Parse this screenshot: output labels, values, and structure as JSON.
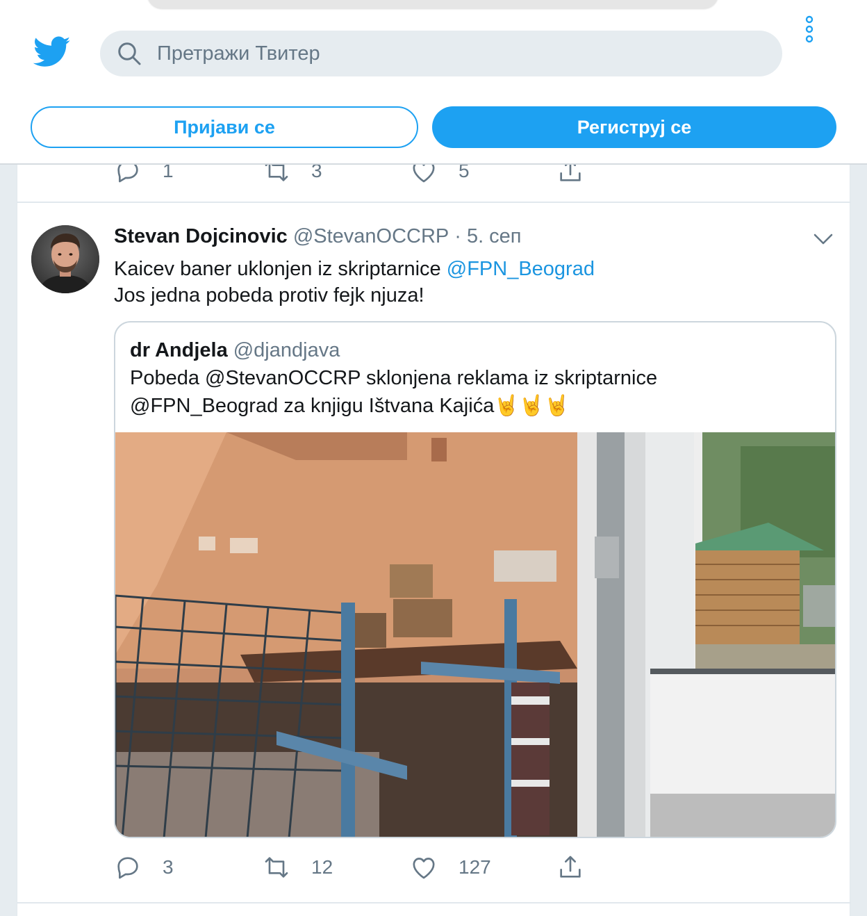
{
  "header": {
    "search_placeholder": "Претражи Твитер",
    "login_label": "Пријави се",
    "signup_label": "Региструј се"
  },
  "previous_tweet_actions": {
    "replies": "1",
    "retweets": "3",
    "likes": "5"
  },
  "tweet": {
    "author_name": "Stevan Dojcinovic",
    "author_handle": "@StevanOCCRP",
    "separator": "·",
    "date": "5. сеп",
    "text_line1": "Kaicev baner uklonjen iz skriptarnice ",
    "text_line1_mention": "@FPN_Beograd",
    "text_line2": "Jos jedna pobeda protiv fejk njuza!",
    "quoted": {
      "author_name": "dr Andjela",
      "author_handle": "@djandjava",
      "text_line1": "Pobeda @StevanOCCRP sklonjena reklama iz skriptarnice",
      "text_line2": "@FPN_Beograd za knjigu Ištvana Kajića🤘🤘🤘"
    },
    "actions": {
      "replies": "3",
      "retweets": "12",
      "likes": "127"
    }
  },
  "colors": {
    "brand": "#1da1f2",
    "mention": "#1b95e0",
    "muted": "#657786"
  }
}
